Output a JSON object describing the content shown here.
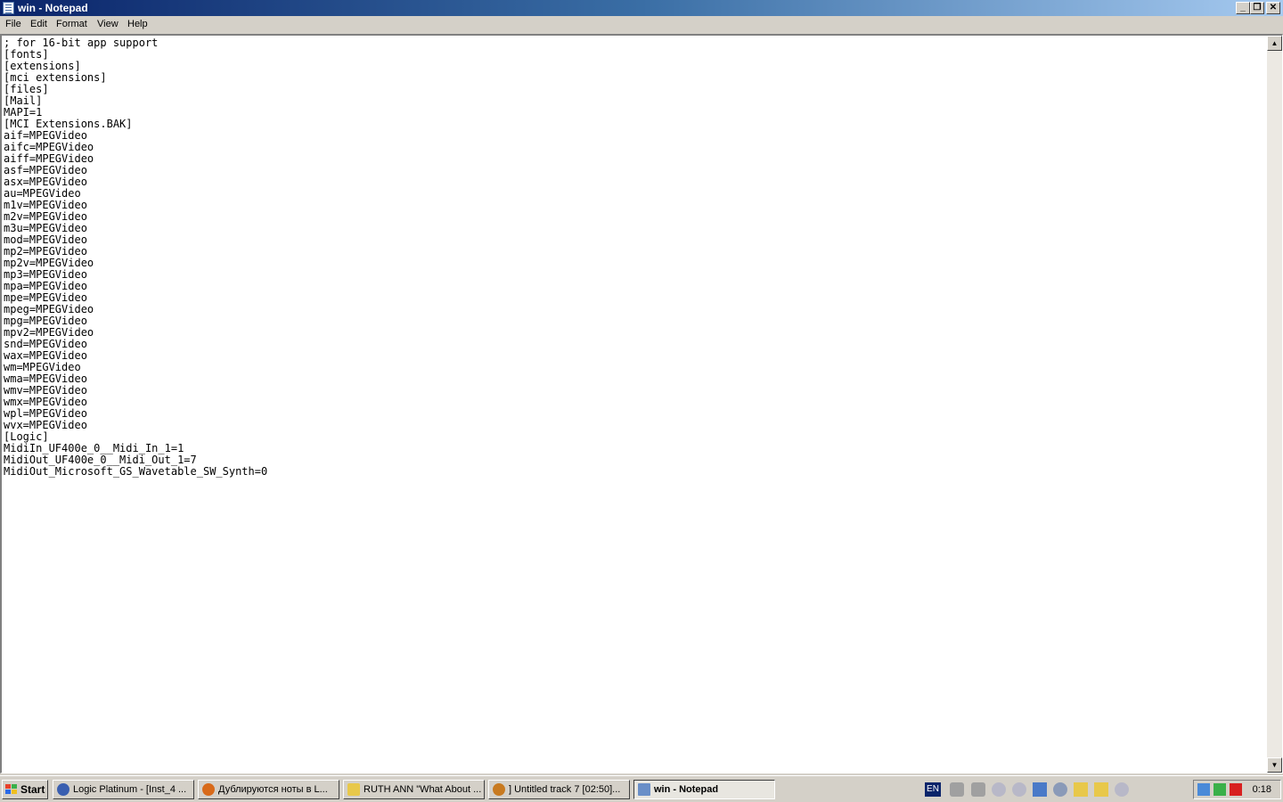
{
  "window": {
    "title": "win - Notepad",
    "controls": {
      "minimize": "_",
      "restore": "❐",
      "close": "✕"
    }
  },
  "menubar": {
    "items": [
      {
        "label": "File"
      },
      {
        "label": "Edit"
      },
      {
        "label": "Format"
      },
      {
        "label": "View"
      },
      {
        "label": "Help"
      }
    ]
  },
  "editor": {
    "lines": [
      "; for 16-bit app support",
      "[fonts]",
      "[extensions]",
      "[mci extensions]",
      "[files]",
      "[Mail]",
      "MAPI=1",
      "[MCI Extensions.BAK]",
      "aif=MPEGVideo",
      "aifc=MPEGVideo",
      "aiff=MPEGVideo",
      "asf=MPEGVideo",
      "asx=MPEGVideo",
      "au=MPEGVideo",
      "m1v=MPEGVideo",
      "m2v=MPEGVideo",
      "m3u=MPEGVideo",
      "mod=MPEGVideo",
      "mp2=MPEGVideo",
      "mp2v=MPEGVideo",
      "mp3=MPEGVideo",
      "mpa=MPEGVideo",
      "mpe=MPEGVideo",
      "mpeg=MPEGVideo",
      "mpg=MPEGVideo",
      "mpv2=MPEGVideo",
      "snd=MPEGVideo",
      "wax=MPEGVideo",
      "wm=MPEGVideo",
      "wma=MPEGVideo",
      "wmv=MPEGVideo",
      "wmx=MPEGVideo",
      "wpl=MPEGVideo",
      "wvx=MPEGVideo",
      "[Logic]",
      "MidiIn_UF400e_0__Midi_In_1=1",
      "MidiOut_UF400e_0__Midi_Out_1=7",
      "MidiOut_Microsoft_GS_Wavetable_SW_Synth=0"
    ]
  },
  "scrollbar": {
    "up": "▲",
    "down": "▼"
  },
  "taskbar": {
    "start_label": "Start",
    "tasks": [
      {
        "label": "Logic Platinum - [Inst_4 ...",
        "icon": "logic-icon",
        "color": "#3a5fb0"
      },
      {
        "label": "Дублируются ноты в L...",
        "icon": "firefox-icon",
        "color": "#d86a1a"
      },
      {
        "label": "RUTH ANN \"What About ...",
        "icon": "folder-icon",
        "color": "#e8c84a"
      },
      {
        "label": "] Untitled track 7 [02:50]...",
        "icon": "winamp-icon",
        "color": "#c87a20"
      },
      {
        "label": "win - Notepad",
        "icon": "notepad-icon",
        "color": "#6a8fc8"
      }
    ],
    "language": "EN",
    "clock": "0:18"
  }
}
